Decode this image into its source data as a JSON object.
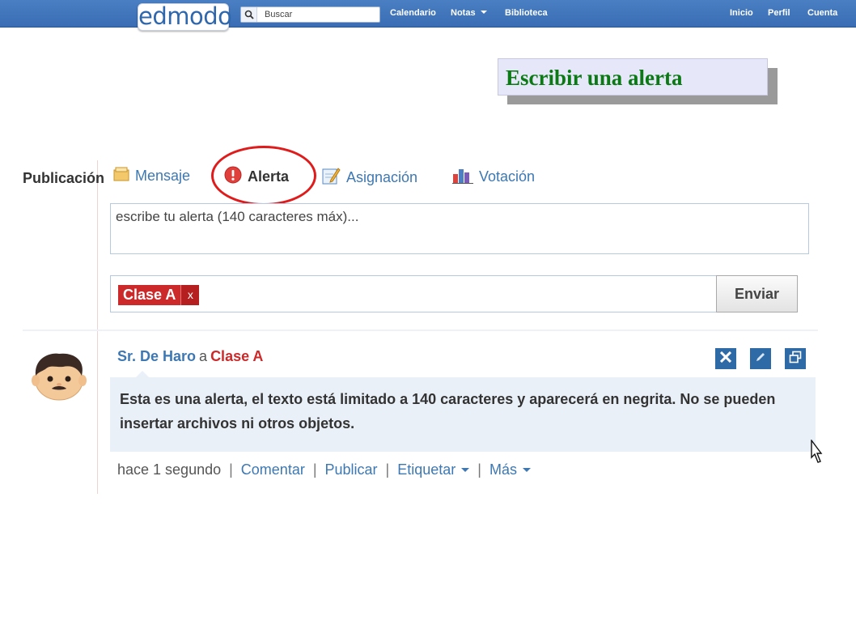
{
  "topbar": {
    "logo": "edmodo",
    "search_placeholder": "Buscar",
    "nav_left": [
      "Calendario",
      "Notas",
      "Biblioteca"
    ],
    "nav_right": [
      "Inicio",
      "Perfil",
      "Cuenta"
    ]
  },
  "overlay_title": "Escribir una alerta",
  "composer": {
    "label": "Publicación",
    "tabs": [
      "Mensaje",
      "Alerta",
      "Asignación",
      "Votación"
    ],
    "active_tab": "Alerta",
    "placeholder": "escribe tu alerta (140 caracteres máx)...",
    "recipient_tag": "Clase A",
    "recipient_remove": "x",
    "send_label": "Enviar"
  },
  "post": {
    "author": "Sr. De Haro",
    "to_word": "a",
    "target": "Clase A",
    "body": "Esta es una alerta, el texto está limitado a 140 caracteres y aparecerá en negrita. No se pueden insertar archivos ni otros objetos.",
    "time": "hace 1 segundo",
    "actions": [
      "Comentar",
      "Publicar",
      "Etiquetar",
      "Más"
    ]
  },
  "colors": {
    "topbar": "#3a6db3",
    "link": "#3d78b3",
    "alert_red": "#cc2a2a",
    "highlight_circle": "#e01b1b",
    "title_green": "#0b7a15"
  }
}
